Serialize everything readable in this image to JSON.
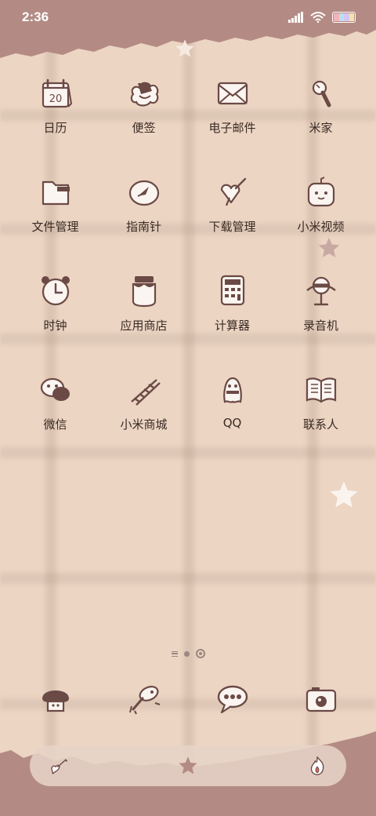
{
  "status_bar": {
    "time": "2:36",
    "battery_colors": [
      "#f4b3b9",
      "#b9e0f2",
      "#d7c6f4",
      "#f4e3b0"
    ]
  },
  "theme": {
    "band_color": "#b48b84",
    "icon_stroke": "#6b4a45"
  },
  "apps": [
    {
      "label": "日历",
      "icon": "calendar-icon",
      "date": "20"
    },
    {
      "label": "便签",
      "icon": "notes-icon"
    },
    {
      "label": "电子邮件",
      "icon": "mail-icon"
    },
    {
      "label": "米家",
      "icon": "mijia-icon"
    },
    {
      "label": "文件管理",
      "icon": "folder-icon"
    },
    {
      "label": "指南针",
      "icon": "compass-icon"
    },
    {
      "label": "下载管理",
      "icon": "download-icon"
    },
    {
      "label": "小米视频",
      "icon": "video-icon"
    },
    {
      "label": "时钟",
      "icon": "clock-icon"
    },
    {
      "label": "应用商店",
      "icon": "app-store-icon"
    },
    {
      "label": "计算器",
      "icon": "calculator-icon"
    },
    {
      "label": "录音机",
      "icon": "recorder-icon"
    },
    {
      "label": "微信",
      "icon": "wechat-icon"
    },
    {
      "label": "小米商城",
      "icon": "mi-store-icon"
    },
    {
      "label": "QQ",
      "icon": "qq-icon"
    },
    {
      "label": "联系人",
      "icon": "contacts-icon"
    }
  ],
  "dock": [
    {
      "icon": "phone-icon"
    },
    {
      "icon": "browser-icon"
    },
    {
      "icon": "messages-icon"
    },
    {
      "icon": "camera-icon"
    }
  ],
  "page_indicator": {
    "pages": 2,
    "current": 2
  },
  "search_bar": {
    "left_icon": "pen-icon",
    "center_icon": "star-icon",
    "right_icon": "flame-icon"
  }
}
